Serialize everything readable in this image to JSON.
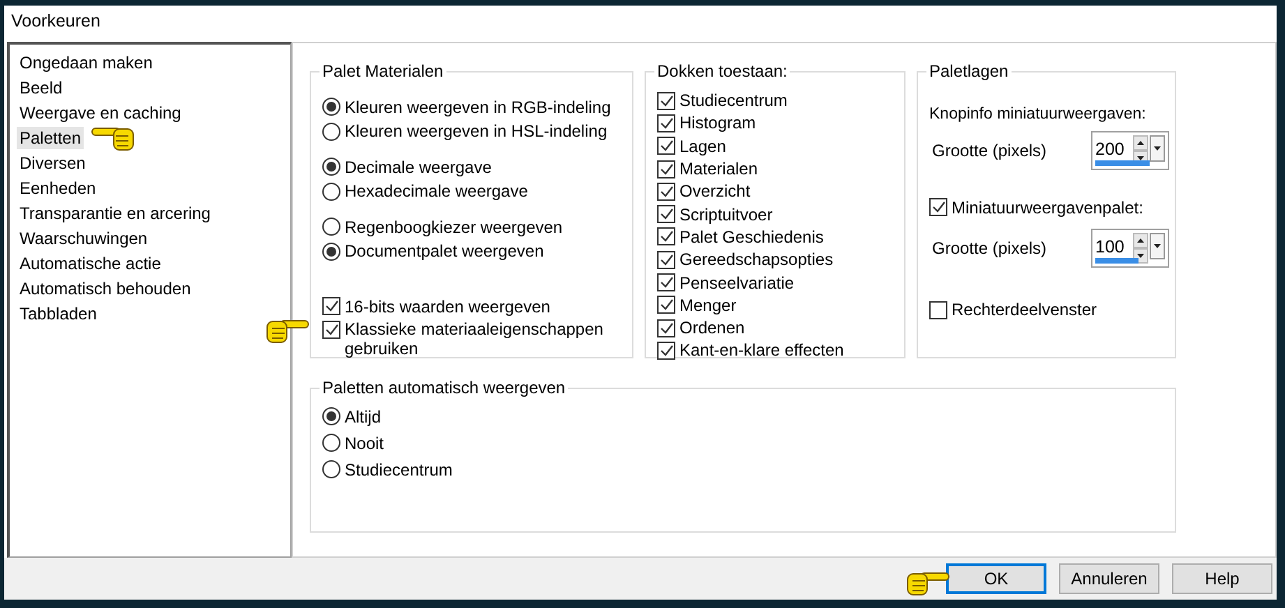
{
  "window": {
    "title": "Voorkeuren"
  },
  "sidebar": {
    "items": [
      {
        "label": "Ongedaan maken",
        "selected": false
      },
      {
        "label": "Beeld",
        "selected": false
      },
      {
        "label": "Weergave en caching",
        "selected": false
      },
      {
        "label": "Paletten",
        "selected": true
      },
      {
        "label": "Diversen",
        "selected": false
      },
      {
        "label": "Eenheden",
        "selected": false
      },
      {
        "label": "Transparantie en arcering",
        "selected": false
      },
      {
        "label": "Waarschuwingen",
        "selected": false
      },
      {
        "label": "Automatische actie",
        "selected": false
      },
      {
        "label": "Automatisch behouden",
        "selected": false
      },
      {
        "label": "Tabbladen",
        "selected": false
      }
    ]
  },
  "palet_materialen": {
    "title": "Palet Materialen",
    "radio_groups": [
      {
        "options": [
          {
            "label": "Kleuren weergeven in RGB-indeling",
            "selected": true
          },
          {
            "label": "Kleuren weergeven in HSL-indeling",
            "selected": false
          }
        ]
      },
      {
        "options": [
          {
            "label": "Decimale weergave",
            "selected": true
          },
          {
            "label": "Hexadecimale weergave",
            "selected": false
          }
        ]
      },
      {
        "options": [
          {
            "label": "Regenboogkiezer weergeven",
            "selected": false
          },
          {
            "label": "Documentpalet weergeven",
            "selected": true
          }
        ]
      }
    ],
    "checkboxes": [
      {
        "label": "16-bits waarden weergeven",
        "checked": true
      },
      {
        "label": "Klassieke materiaaleigenschappen gebruiken",
        "checked": true
      }
    ]
  },
  "dokken_toestaan": {
    "title": "Dokken toestaan:",
    "items": [
      {
        "label": "Studiecentrum",
        "checked": true
      },
      {
        "label": "Histogram",
        "checked": true
      },
      {
        "label": "Lagen",
        "checked": true
      },
      {
        "label": "Materialen",
        "checked": true
      },
      {
        "label": "Overzicht",
        "checked": true
      },
      {
        "label": "Scriptuitvoer",
        "checked": true
      },
      {
        "label": "Palet Geschiedenis",
        "checked": true
      },
      {
        "label": "Gereedschapsopties",
        "checked": true
      },
      {
        "label": "Penseelvariatie",
        "checked": true
      },
      {
        "label": "Menger",
        "checked": true
      },
      {
        "label": "Ordenen",
        "checked": true
      },
      {
        "label": "Kant-en-klare effecten",
        "checked": true
      }
    ]
  },
  "paletlagen": {
    "title": "Paletlagen",
    "tooltip_thumbnails": {
      "label": "Knopinfo miniatuurweergaven:",
      "size_label": "Grootte (pixels)",
      "value": "200",
      "level": 0.72
    },
    "thumbnail_palette": {
      "label": "Miniatuurweergavenpalet:",
      "checked": true,
      "size_label": "Grootte (pixels)",
      "value": "100",
      "level": 0.58
    },
    "right_pane": {
      "label": "Rechterdeelvenster",
      "checked": false
    }
  },
  "paletten_automatisch": {
    "title": "Paletten automatisch weergeven",
    "options": [
      {
        "label": "Altijd",
        "selected": true
      },
      {
        "label": "Nooit",
        "selected": false
      },
      {
        "label": "Studiecentrum",
        "selected": false
      }
    ]
  },
  "buttons": [
    {
      "label": "OK",
      "default": true
    },
    {
      "label": "Annuleren",
      "default": false
    },
    {
      "label": "Help",
      "default": false
    }
  ]
}
